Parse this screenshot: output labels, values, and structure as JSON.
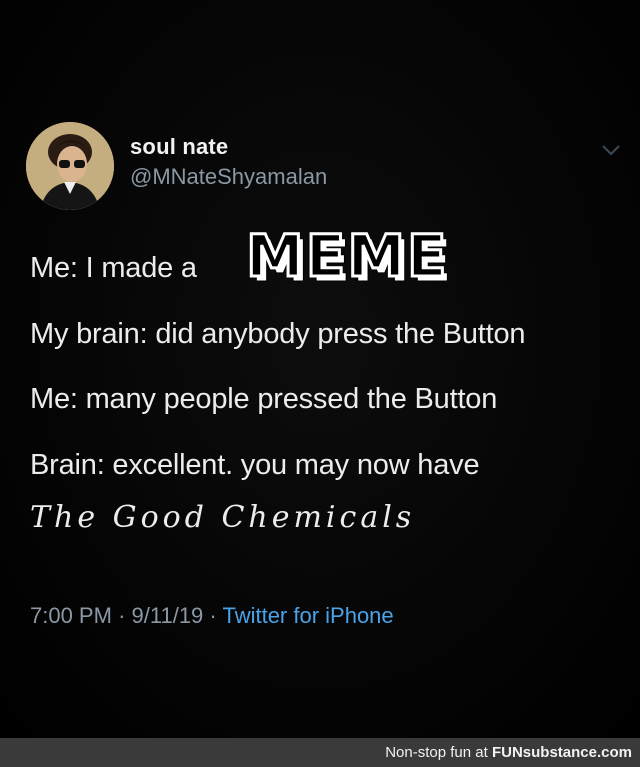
{
  "tweet": {
    "author_name": "soul nate",
    "author_handle": "@MNateShyamalan",
    "lines": [
      "Me: I made a",
      "My brain: did anybody press the Button",
      "Me: many people pressed the Button",
      "Brain: excellent. you may now have"
    ],
    "meme_word": "MEME",
    "good_chemicals": "The Good Chemicals",
    "time": "7:00 PM",
    "date": "9/11/19",
    "separator": "·",
    "source": "Twitter for iPhone"
  },
  "footer": {
    "prefix": "Non-stop fun at ",
    "brand": "FUNsubstance.com"
  },
  "icons": {
    "avatar": "portrait-avatar-icon",
    "menu": "chevron-down-icon"
  },
  "colors": {
    "background": "#000000",
    "text": "#ececec",
    "muted": "#8b98a5",
    "link": "#4aa3e8",
    "footer_bg": "#3a3a3a"
  }
}
